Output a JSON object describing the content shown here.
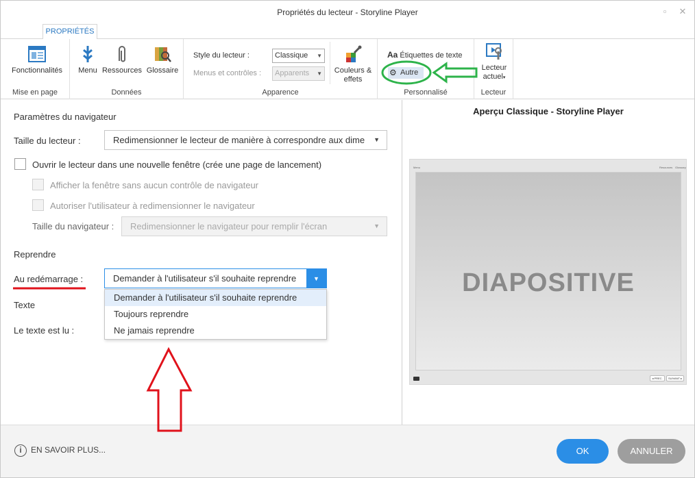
{
  "window": {
    "title": "Propriétés du lecteur - Storyline Player",
    "tab": "PROPRIÉTÉS"
  },
  "ribbon": {
    "mise_en_page": {
      "label": "Mise en page",
      "fonctionnalites": "Fonctionnalités"
    },
    "donnees": {
      "label": "Données",
      "menu": "Menu",
      "ressources": "Ressources",
      "glossaire": "Glossaire"
    },
    "apparence": {
      "label": "Apparence",
      "style_label": "Style du lecteur :",
      "style_value": "Classique",
      "menus_label": "Menus et contrôles :",
      "menus_value": "Apparents",
      "couleurs": "Couleurs &",
      "effets": "effets"
    },
    "personnalise": {
      "label": "Personnalisé",
      "etiquettes_prefix": "Aa",
      "etiquettes": "Étiquettes de texte",
      "autre": "Autre"
    },
    "lecteur": {
      "label": "Lecteur",
      "lecteur_line1": "Lecteur",
      "lecteur_line2": "actuel"
    }
  },
  "navigateur": {
    "section": "Paramètres du navigateur",
    "taille_label": "Taille du lecteur :",
    "taille_value": "Redimensionner le lecteur de manière à correspondre aux dime",
    "ouvrir": "Ouvrir le lecteur dans une nouvelle fenêtre (crée une page de lancement)",
    "afficher": "Afficher la fenêtre sans aucun contrôle de navigateur",
    "autoriser": "Autoriser l'utilisateur à redimensionner le navigateur",
    "taille_nav_label": "Taille du navigateur :",
    "taille_nav_value": "Redimensionner le navigateur pour remplir l'écran"
  },
  "reprendre": {
    "section": "Reprendre",
    "au_label": "Au redémarrage :",
    "value": "Demander à l'utilisateur s'il souhaite reprendre",
    "options": [
      "Demander à l'utilisateur s'il souhaite reprendre",
      "Toujours reprendre",
      "Ne jamais reprendre"
    ]
  },
  "texte": {
    "section": "Texte",
    "lu_label": "Le texte est lu :"
  },
  "preview": {
    "title": "Aperçu Classique - Storyline Player",
    "slide_text": "DIAPOSITIVE",
    "top_left": "Menu",
    "top_right_1": "Resources",
    "top_right_2": "Glossary",
    "prev": "◂ PREC.",
    "next": "SUIVANT ▸"
  },
  "footer": {
    "info": "EN SAVOIR PLUS...",
    "ok": "OK",
    "cancel": "ANNULER"
  },
  "colors": {
    "accent": "#2b8ee6",
    "annotation_green": "#2db34a",
    "annotation_red": "#e0121b"
  }
}
